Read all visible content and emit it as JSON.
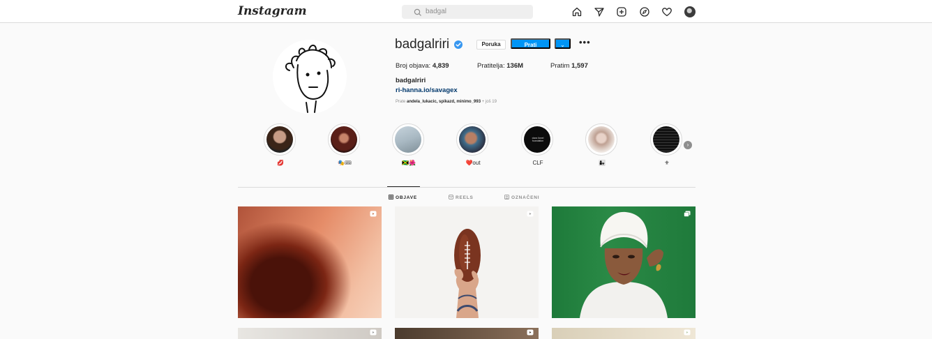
{
  "app": {
    "logo_text": "Instagram",
    "logo_caret": "⌄"
  },
  "search": {
    "value": "badgal"
  },
  "nav_icons": [
    "home-icon",
    "direct-icon",
    "new-post-icon",
    "explore-icon",
    "activity-icon",
    "profile-avatar"
  ],
  "profile": {
    "username": "badgalriri",
    "verified": true,
    "message_button": "Poruka",
    "follow_button": "Prati",
    "dropdown_button": "⌄",
    "more_button": "•••",
    "stats": {
      "posts_label": "Broj objava:",
      "posts_value": "4,839",
      "followers_label": "Pratitelja:",
      "followers_value": "136M",
      "following_label": "Pratim",
      "following_value": "1,597"
    },
    "full_name": "badgalriri",
    "bio_link": "ri-hanna.io/savagex",
    "followed_by_prefix": "Prate",
    "followed_by_names": "andela_lukacic, spikazd, minimo_993",
    "followed_by_suffix": "+ još 19"
  },
  "highlights": [
    {
      "label": "💋"
    },
    {
      "label": "🎭🎟"
    },
    {
      "label": "🇯🇲🌺"
    },
    {
      "label": "❤️out"
    },
    {
      "label": "CLF"
    },
    {
      "label": "👩‍👧"
    },
    {
      "label": "⚜"
    }
  ],
  "highlight_clf_text": "clara lionel foundation",
  "tabs": [
    {
      "label": "OBJAVE",
      "active": true
    },
    {
      "label": "REELS",
      "active": false
    },
    {
      "label": "OZNAČENI",
      "active": false
    }
  ],
  "colors": {
    "accent": "#0095f6",
    "verified": "#3897f0",
    "link": "#00376b",
    "text": "#262626",
    "muted": "#8e8e8e",
    "border": "#dbdbdb"
  }
}
